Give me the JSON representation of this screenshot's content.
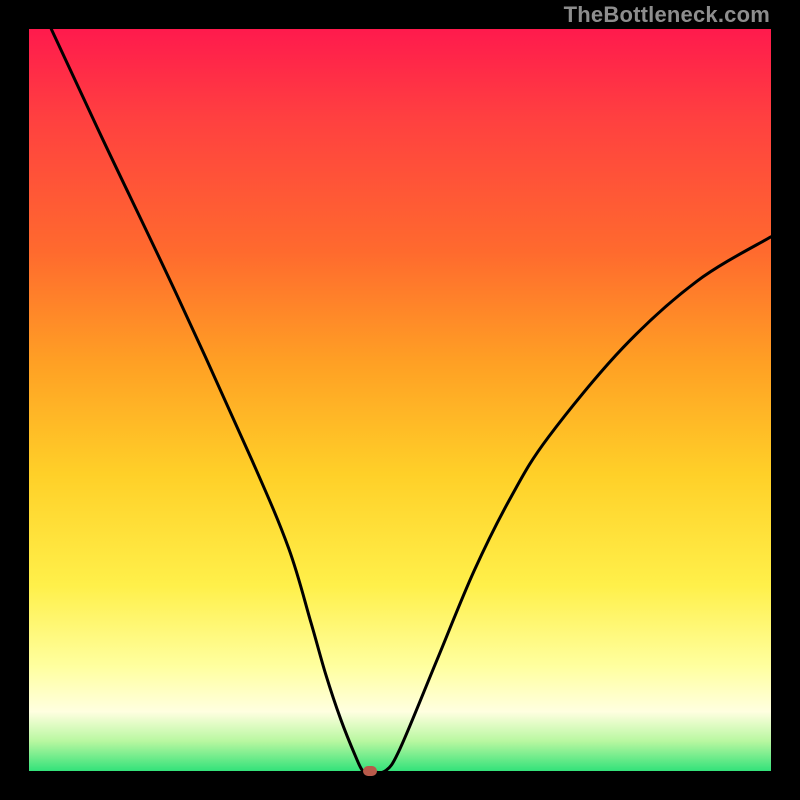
{
  "watermark": "TheBottleneck.com",
  "chart_data": {
    "type": "line",
    "title": "",
    "xlabel": "",
    "ylabel": "",
    "xlim": [
      0,
      100
    ],
    "ylim": [
      0,
      100
    ],
    "grid": false,
    "legend": false,
    "series": [
      {
        "name": "curve",
        "x": [
          3,
          10,
          20,
          30,
          35,
          38,
          40,
          42,
          44,
          45,
          46,
          48,
          50,
          55,
          60,
          65,
          70,
          80,
          90,
          100
        ],
        "y": [
          100,
          85,
          64,
          42,
          30,
          20,
          13,
          7,
          2,
          0,
          0,
          0,
          3,
          15,
          27,
          37,
          45,
          57,
          66,
          72
        ]
      }
    ],
    "marker": {
      "x": 46,
      "y": 0
    },
    "background_gradient": {
      "stops": [
        {
          "pct": 0,
          "color": "#ff1a4d"
        },
        {
          "pct": 30,
          "color": "#ff6a2e"
        },
        {
          "pct": 60,
          "color": "#ffd028"
        },
        {
          "pct": 86,
          "color": "#ffffa0"
        },
        {
          "pct": 100,
          "color": "#33e27a"
        }
      ]
    }
  }
}
